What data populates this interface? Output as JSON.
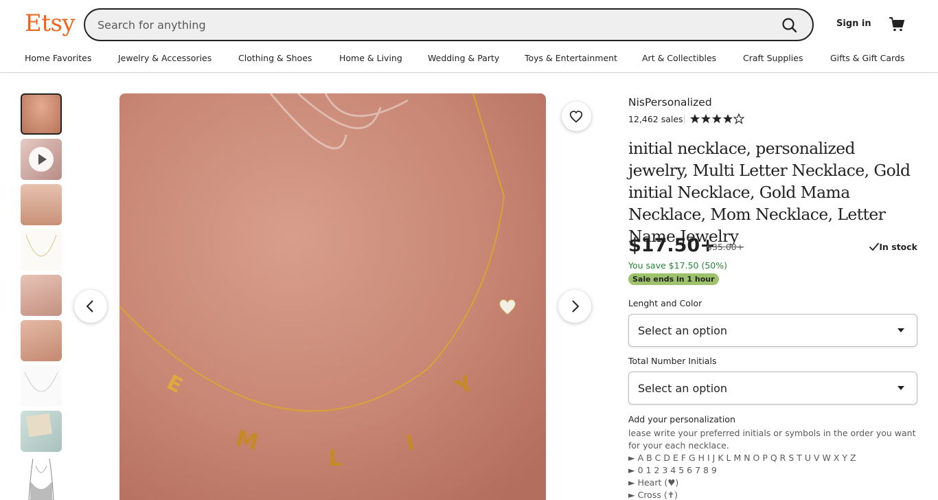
{
  "header": {
    "logo": "Etsy",
    "search_placeholder": "Search for anything",
    "sign_in": "Sign in"
  },
  "nav": [
    "Home Favorites",
    "Jewelry & Accessories",
    "Clothing & Shoes",
    "Home & Living",
    "Wedding & Party",
    "Toys & Entertainment",
    "Art & Collectibles",
    "Craft Supplies",
    "Gifts & Gift Cards"
  ],
  "listing": {
    "shop_name": "NisPersonalized",
    "sales": "12,462 sales",
    "rating": 4.5,
    "title": "initial necklace, personalized jewelry, Multi Letter Necklace, Gold initial Necklace, Gold Mama Necklace, Mom Necklace, Letter Name Jewelry",
    "price": "$17.50+",
    "original_price": "$35.00+",
    "stock": "In stock",
    "savings": "You save $17.50 (50%)",
    "sale_badge": "Sale ends in 1 hour",
    "option1_label": "Lenght and Color",
    "option1_value": "Select an option",
    "option2_label": "Total Number Initials",
    "option2_value": "Select an option",
    "personalization_heading": "Add your personalization",
    "personalization_lines": [
      "lease write your preferred initials or symbols in the order you want",
      "for your each necklace.",
      "► A B C D E F G H I J K L M N O P Q R S T U V W X Y Z",
      "► 0 1 2 3 4 5 6 7 8 9",
      "► Heart (♥)",
      "► Cross (✝)"
    ]
  },
  "image_letters": [
    "E",
    "M",
    "L",
    "I",
    "Y"
  ],
  "colors": {
    "brand": "#F1641E",
    "sale_badge": "#9EC26B",
    "savings_text": "#258635"
  }
}
